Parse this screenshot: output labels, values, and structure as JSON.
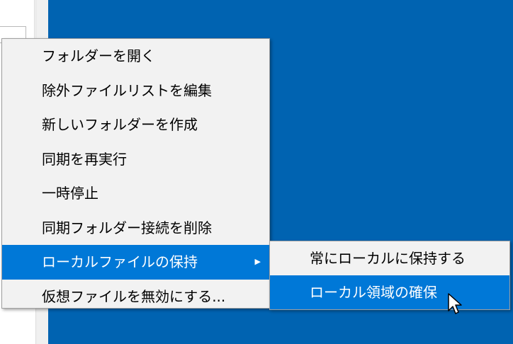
{
  "context_menu": {
    "items": [
      {
        "label": "フォルダーを開く"
      },
      {
        "label": "除外ファイルリストを編集"
      },
      {
        "label": "新しいフォルダーを作成"
      },
      {
        "label": "同期を再実行"
      },
      {
        "label": "一時停止"
      },
      {
        "label": "同期フォルダー接続を削除"
      },
      {
        "label": "ローカルファイルの保持",
        "submenu_arrow": "▶"
      },
      {
        "label": "仮想ファイルを無効にする..."
      }
    ],
    "highlighted_index": 6
  },
  "submenu": {
    "items": [
      {
        "label": "常にローカルに保持する"
      },
      {
        "label": "ローカル領域の確保"
      }
    ],
    "highlighted_index": 1
  },
  "colors": {
    "desktop_background": "#0063b1",
    "menu_background": "#f2f2f2",
    "highlight": "#0078d7"
  },
  "icons": {
    "submenu_arrow": "chevron-right-icon",
    "cursor": "mouse-pointer-icon"
  }
}
